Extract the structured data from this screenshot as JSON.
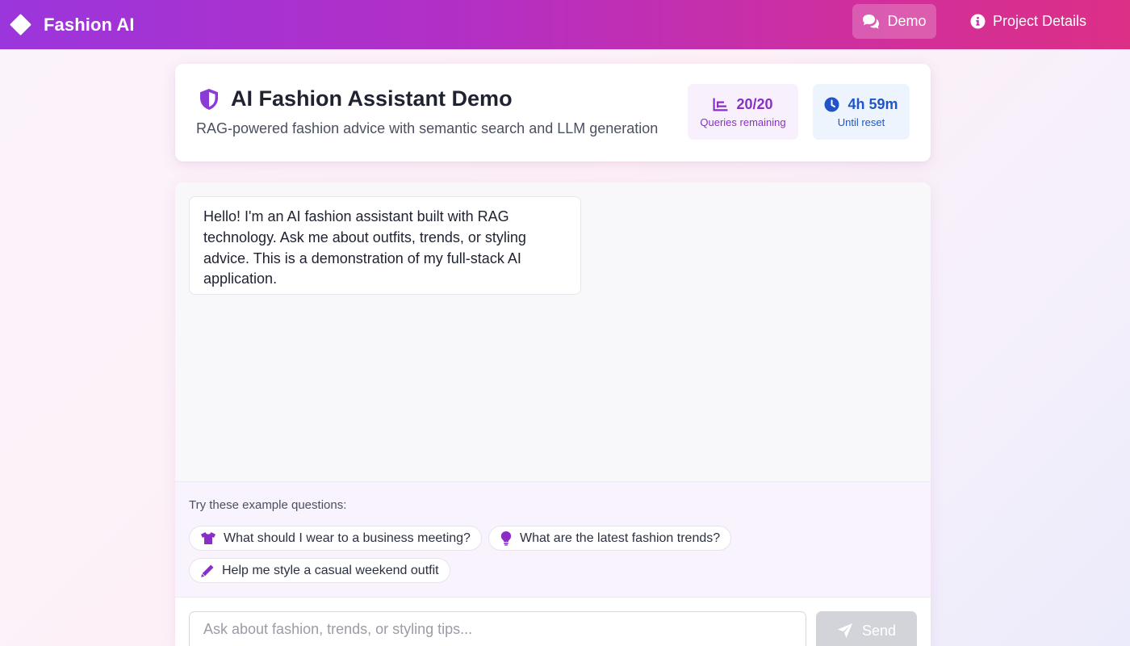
{
  "navbar": {
    "brand_title": "Fashion AI",
    "brand_icon": "diamond-icon",
    "links": [
      {
        "label": "Demo",
        "icon": "comments-icon",
        "active": true
      },
      {
        "label": "Project Details",
        "icon": "info-circle-icon",
        "active": false
      }
    ]
  },
  "header": {
    "title": "AI Fashion Assistant Demo",
    "title_icon": "shield-icon",
    "subtitle": "RAG-powered fashion advice with semantic search and LLM generation",
    "stats": {
      "queries": {
        "value": "20/20",
        "label": "Queries remaining",
        "icon": "bar-chart-icon"
      },
      "reset": {
        "value": "4h 59m",
        "label": "Until reset",
        "icon": "clock-icon"
      }
    }
  },
  "chat": {
    "messages": [
      {
        "role": "assistant",
        "text": "Hello! I'm an AI fashion assistant built with RAG technology. Ask me about outfits, trends, or styling advice. This is a demonstration of my full-stack AI application."
      }
    ],
    "examples_label": "Try these example questions:",
    "examples": [
      {
        "text": "What should I wear to a business meeting?",
        "icon": "shirt-icon"
      },
      {
        "text": "What are the latest fashion trends?",
        "icon": "lightbulb-icon"
      },
      {
        "text": "Help me style a casual weekend outfit",
        "icon": "pencil-icon"
      }
    ],
    "input": {
      "value": "",
      "placeholder": "Ask about fashion, trends, or styling tips..."
    },
    "send_label": "Send",
    "send_icon": "paper-plane-icon"
  },
  "colors": {
    "navbar_gradient_start": "#9b36dc",
    "navbar_gradient_end": "#dc2f86",
    "accent_purple": "#8a2fc6",
    "accent_blue": "#1f55c8",
    "send_disabled": "#d2d4d9"
  }
}
